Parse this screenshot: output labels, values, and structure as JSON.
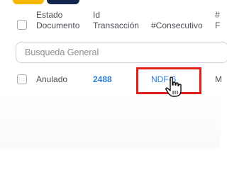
{
  "table": {
    "columns": [
      {
        "line1": "Estado",
        "line2": "Documento"
      },
      {
        "line1": "Id",
        "line2": "Transacción"
      },
      {
        "line1": "",
        "line2": "#Consecutivo"
      },
      {
        "line1": "#",
        "line2": "F"
      }
    ],
    "rows": [
      {
        "estado": "Anulado",
        "id": "2488",
        "consecutivo": "NDF-6",
        "next": "M"
      }
    ]
  },
  "search": {
    "placeholder": "Busqueda General"
  },
  "colors": {
    "accent_yellow": "#f5b800",
    "accent_navy": "#14264f",
    "link": "#2d7fd3",
    "highlight": "#e0201c"
  },
  "icons": {
    "cursor": "hand-pointer-icon"
  }
}
